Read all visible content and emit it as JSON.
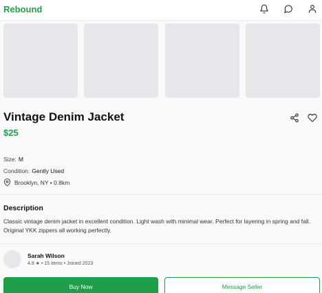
{
  "app": {
    "name": "Rebound",
    "accent_color": "#1e9e48"
  },
  "header": {
    "icons": [
      "bell-icon",
      "chat-icon",
      "user-icon"
    ]
  },
  "gallery": {
    "image_count": 4
  },
  "listing": {
    "title": "Vintage Denim Jacket",
    "price": "$25",
    "actions": [
      "share-icon",
      "heart-icon"
    ],
    "size_label": "Size:",
    "size_value": "M",
    "condition_label": "Condition:",
    "condition_value": "Gently Used",
    "location": "Brooklyn, NY • 0.8km",
    "description_heading": "Description",
    "description": "Classic vintage denim jacket in excellent condition. Light wash with minimal wear. Perfect for layering in spring and fall. Original YKK zippers all working perfectly."
  },
  "seller": {
    "name": "Sarah Wilson",
    "meta": "4.8 ★ • 15 items • Joined 2023"
  },
  "buttons": {
    "buy": "Buy Now",
    "message": "Message Seller"
  }
}
